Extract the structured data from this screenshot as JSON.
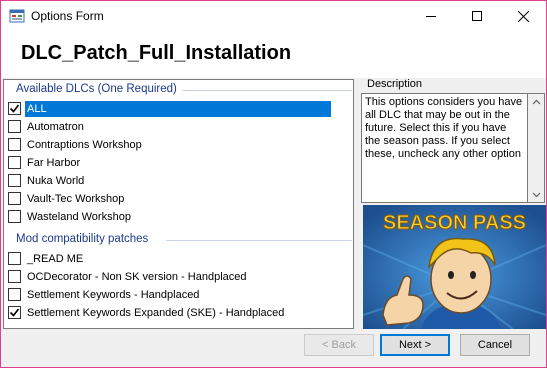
{
  "window": {
    "title": "Options Form",
    "controls": {
      "minimize": "minimize",
      "maximize": "maximize",
      "close": "close"
    }
  },
  "header": {
    "title": "DLC_Patch_Full_Installation"
  },
  "groups": [
    {
      "label": "Available DLCs (One Required)",
      "items": [
        {
          "label": "ALL",
          "checked": true,
          "selected": true
        },
        {
          "label": "Automatron",
          "checked": false
        },
        {
          "label": "Contraptions Workshop",
          "checked": false
        },
        {
          "label": "Far Harbor",
          "checked": false
        },
        {
          "label": "Nuka World",
          "checked": false
        },
        {
          "label": "Vault-Tec Workshop",
          "checked": false
        },
        {
          "label": "Wasteland Workshop",
          "checked": false
        }
      ]
    },
    {
      "label": "Mod compatibility patches",
      "items": [
        {
          "label": "_READ ME",
          "checked": false
        },
        {
          "label": "OCDecorator - Non SK version - Handplaced",
          "checked": false
        },
        {
          "label": "Settlement Keywords - Handplaced",
          "checked": false
        },
        {
          "label": "Settlement Keywords Expanded (SKE) - Handplaced",
          "checked": true
        }
      ]
    }
  ],
  "description": {
    "label": "Description",
    "text": "This options considers you have all DLC that may be out in the future. Select this if you have the season pass. If you select these, uncheck any other option"
  },
  "preview": {
    "banner_text": "SEASON PASS"
  },
  "buttons": {
    "back": "< Back",
    "next": "Next >",
    "cancel": "Cancel"
  },
  "colors": {
    "accent": "#0078d7",
    "group_header": "#1e3a8a",
    "window_border": "#e0408a"
  }
}
